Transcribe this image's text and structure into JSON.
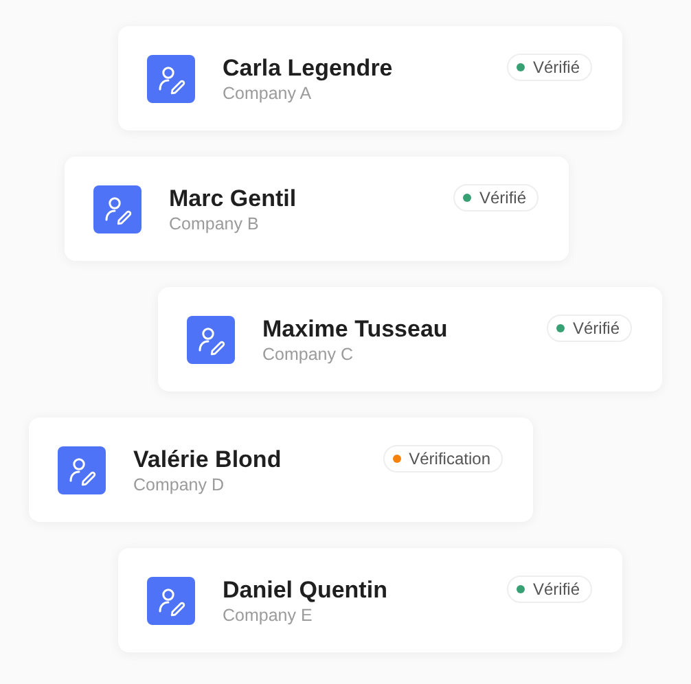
{
  "contacts": [
    {
      "name": "Carla Legendre",
      "company": "Company A",
      "status": {
        "label": "Vérifié",
        "color": "#38a174"
      }
    },
    {
      "name": "Marc Gentil",
      "company": "Company B",
      "status": {
        "label": "Vérifié",
        "color": "#38a174"
      }
    },
    {
      "name": "Maxime Tusseau",
      "company": "Company C",
      "status": {
        "label": "Vérifié",
        "color": "#38a174"
      }
    },
    {
      "name": "Valérie Blond",
      "company": "Company D",
      "status": {
        "label": "Vérification",
        "color": "#f5820d"
      }
    },
    {
      "name": "Daniel Quentin",
      "company": "Company E",
      "status": {
        "label": "Vérifié",
        "color": "#38a174"
      }
    }
  ]
}
